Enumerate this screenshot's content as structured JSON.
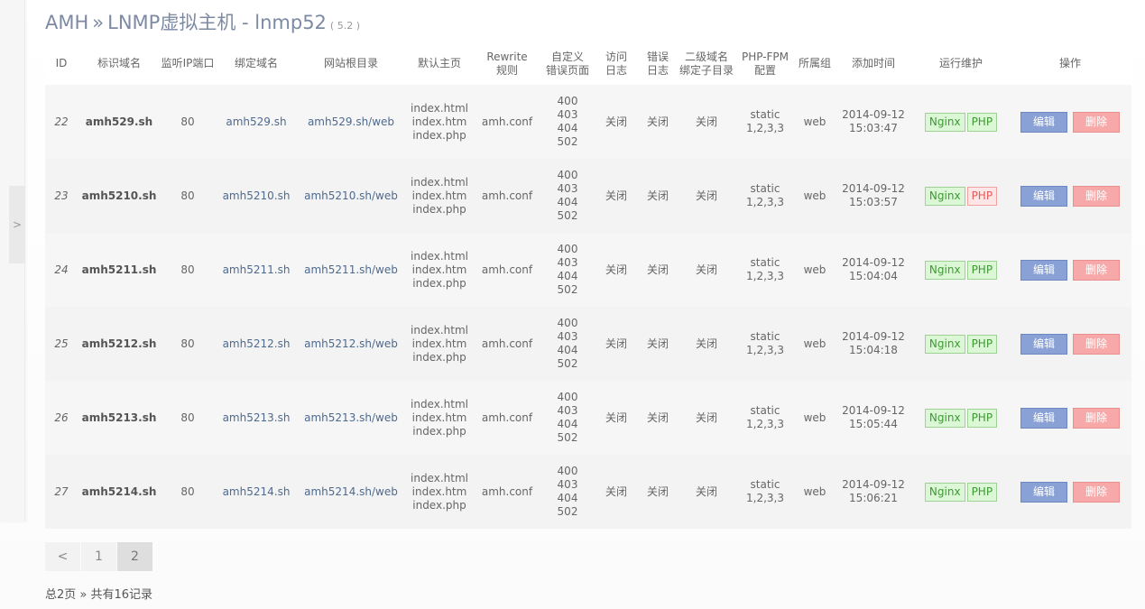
{
  "header": {
    "brand": "AMH",
    "separator": "»",
    "title": "LNMP虚拟主机 - lnmp52",
    "version": "( 5.2 )"
  },
  "sidebar": {
    "toggle_label": ">"
  },
  "table": {
    "columns": [
      [
        "ID"
      ],
      [
        "标识域名"
      ],
      [
        "监听IP端口"
      ],
      [
        "绑定域名"
      ],
      [
        "网站根目录"
      ],
      [
        "默认主页"
      ],
      [
        "Rewrite",
        "规则"
      ],
      [
        "自定义",
        "错误页面"
      ],
      [
        "访问",
        "日志"
      ],
      [
        "错误",
        "日志"
      ],
      [
        "二级域名",
        "绑定子目录"
      ],
      [
        "PHP-FPM",
        "配置"
      ],
      [
        "所属组"
      ],
      [
        "添加时间"
      ],
      [
        "运行维护"
      ],
      [
        "操作"
      ]
    ],
    "rows": [
      {
        "id": "22",
        "name": "amh529.sh",
        "port": "80",
        "domain": "amh529.sh",
        "root": "amh529.sh/web",
        "index": [
          "index.html",
          "index.htm",
          "index.php"
        ],
        "rewrite": "amh.conf",
        "errors": [
          "400",
          "403",
          "404",
          "502"
        ],
        "access_log": "关闭",
        "error_log": "关闭",
        "subdir": "关闭",
        "fpm": [
          "static",
          "1,2,3,3"
        ],
        "group": "web",
        "date": "2014-09-12",
        "time": "15:03:47",
        "nginx": "Nginx",
        "nginx_state": "ok",
        "php": "PHP",
        "php_state": "ok",
        "edit": "编辑",
        "delete": "删除"
      },
      {
        "id": "23",
        "name": "amh5210.sh",
        "port": "80",
        "domain": "amh5210.sh",
        "root": "amh5210.sh/web",
        "index": [
          "index.html",
          "index.htm",
          "index.php"
        ],
        "rewrite": "amh.conf",
        "errors": [
          "400",
          "403",
          "404",
          "502"
        ],
        "access_log": "关闭",
        "error_log": "关闭",
        "subdir": "关闭",
        "fpm": [
          "static",
          "1,2,3,3"
        ],
        "group": "web",
        "date": "2014-09-12",
        "time": "15:03:57",
        "nginx": "Nginx",
        "nginx_state": "ok",
        "php": "PHP",
        "php_state": "off",
        "edit": "编辑",
        "delete": "删除"
      },
      {
        "id": "24",
        "name": "amh5211.sh",
        "port": "80",
        "domain": "amh5211.sh",
        "root": "amh5211.sh/web",
        "index": [
          "index.html",
          "index.htm",
          "index.php"
        ],
        "rewrite": "amh.conf",
        "errors": [
          "400",
          "403",
          "404",
          "502"
        ],
        "access_log": "关闭",
        "error_log": "关闭",
        "subdir": "关闭",
        "fpm": [
          "static",
          "1,2,3,3"
        ],
        "group": "web",
        "date": "2014-09-12",
        "time": "15:04:04",
        "nginx": "Nginx",
        "nginx_state": "ok",
        "php": "PHP",
        "php_state": "ok",
        "edit": "编辑",
        "delete": "删除"
      },
      {
        "id": "25",
        "name": "amh5212.sh",
        "port": "80",
        "domain": "amh5212.sh",
        "root": "amh5212.sh/web",
        "index": [
          "index.html",
          "index.htm",
          "index.php"
        ],
        "rewrite": "amh.conf",
        "errors": [
          "400",
          "403",
          "404",
          "502"
        ],
        "access_log": "关闭",
        "error_log": "关闭",
        "subdir": "关闭",
        "fpm": [
          "static",
          "1,2,3,3"
        ],
        "group": "web",
        "date": "2014-09-12",
        "time": "15:04:18",
        "nginx": "Nginx",
        "nginx_state": "ok",
        "php": "PHP",
        "php_state": "ok",
        "edit": "编辑",
        "delete": "删除"
      },
      {
        "id": "26",
        "name": "amh5213.sh",
        "port": "80",
        "domain": "amh5213.sh",
        "root": "amh5213.sh/web",
        "index": [
          "index.html",
          "index.htm",
          "index.php"
        ],
        "rewrite": "amh.conf",
        "errors": [
          "400",
          "403",
          "404",
          "502"
        ],
        "access_log": "关闭",
        "error_log": "关闭",
        "subdir": "关闭",
        "fpm": [
          "static",
          "1,2,3,3"
        ],
        "group": "web",
        "date": "2014-09-12",
        "time": "15:05:44",
        "nginx": "Nginx",
        "nginx_state": "ok",
        "php": "PHP",
        "php_state": "ok",
        "edit": "编辑",
        "delete": "删除"
      },
      {
        "id": "27",
        "name": "amh5214.sh",
        "port": "80",
        "domain": "amh5214.sh",
        "root": "amh5214.sh/web",
        "index": [
          "index.html",
          "index.htm",
          "index.php"
        ],
        "rewrite": "amh.conf",
        "errors": [
          "400",
          "403",
          "404",
          "502"
        ],
        "access_log": "关闭",
        "error_log": "关闭",
        "subdir": "关闭",
        "fpm": [
          "static",
          "1,2,3,3"
        ],
        "group": "web",
        "date": "2014-09-12",
        "time": "15:06:21",
        "nginx": "Nginx",
        "nginx_state": "ok",
        "php": "PHP",
        "php_state": "ok",
        "edit": "编辑",
        "delete": "删除"
      }
    ]
  },
  "pagination": {
    "prev": "<",
    "pages": [
      "1",
      "2"
    ],
    "current": "2"
  },
  "summary": "总2页 » 共有16记录"
}
